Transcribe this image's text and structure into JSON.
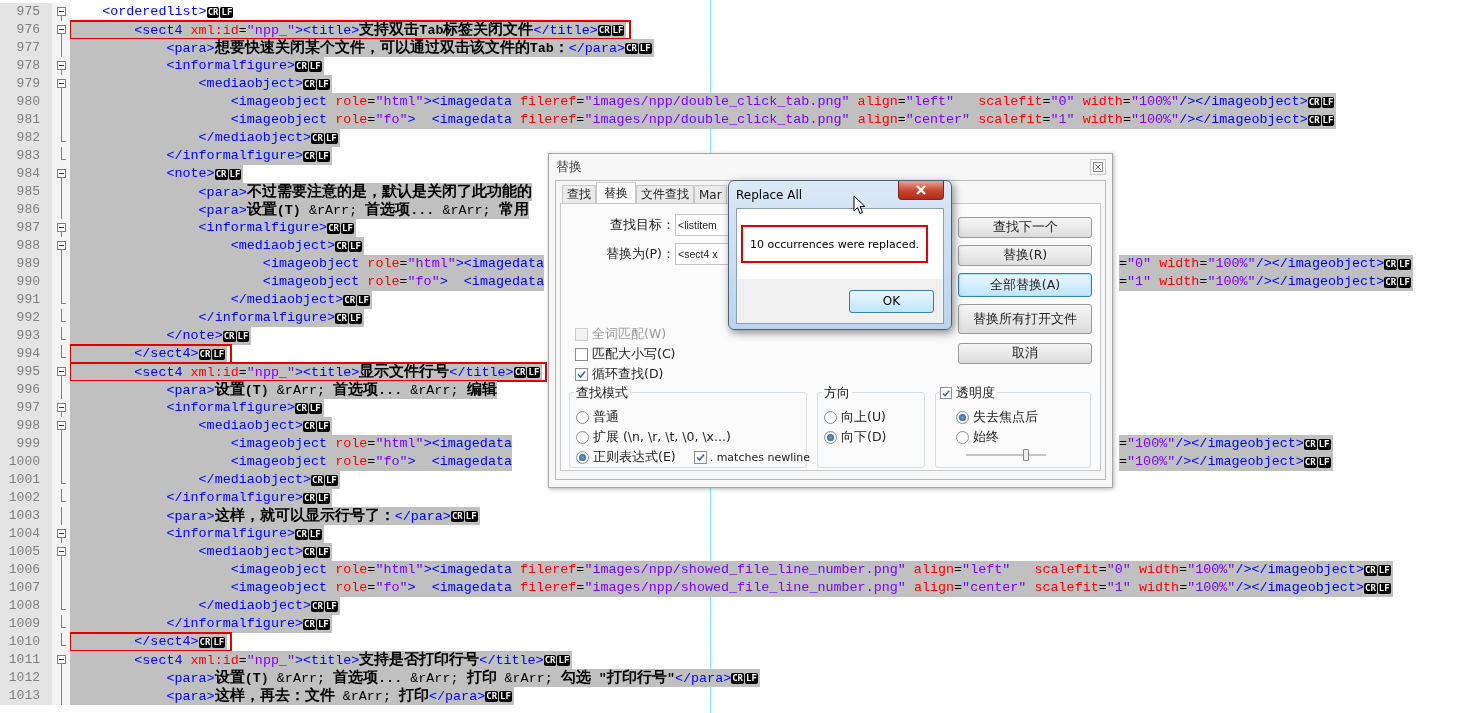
{
  "editor": {
    "lines": [
      {
        "number": "975",
        "kind": "start",
        "text": "    <orderedlist>",
        "eol": [
          "CR",
          "LF"
        ],
        "selected": false,
        "highlight": false
      },
      {
        "number": "976",
        "kind": "start",
        "text": "        <sect4 xml:id=\"npp_\"><title>支持双击Tab标签关闭文件</title>",
        "eol": [
          "CR",
          "LF"
        ],
        "selected": true,
        "highlight": true
      },
      {
        "number": "977",
        "kind": "inner",
        "text": "            <para>想要快速关闭某个文件，可以通过双击该文件的Tab：</para>",
        "eol": [
          "CR",
          "LF"
        ],
        "selected": true,
        "highlight": false
      },
      {
        "number": "978",
        "kind": "start",
        "text": "            <informalfigure>",
        "eol": [
          "CR",
          "LF"
        ],
        "selected": true,
        "highlight": false
      },
      {
        "number": "979",
        "kind": "start",
        "text": "                <mediaobject>",
        "eol": [
          "CR",
          "LF"
        ],
        "selected": true,
        "highlight": false
      },
      {
        "number": "980",
        "kind": "inner",
        "text": "                    <imageobject role=\"html\"><imagedata fileref=\"images/npp/double_click_tab.png\" align=\"left\"   scalefit=\"0\" width=\"100%\"/></imageobject>",
        "eol": [
          "CR",
          "LF"
        ],
        "selected": true,
        "highlight": false
      },
      {
        "number": "981",
        "kind": "inner",
        "text": "                    <imageobject role=\"fo\">  <imagedata fileref=\"images/npp/double_click_tab.png\" align=\"center\" scalefit=\"1\" width=\"100%\"/></imageobject>",
        "eol": [
          "CR",
          "LF"
        ],
        "selected": true,
        "highlight": false
      },
      {
        "number": "982",
        "kind": "end",
        "text": "                </mediaobject>",
        "eol": [
          "CR",
          "LF"
        ],
        "selected": true,
        "highlight": false
      },
      {
        "number": "983",
        "kind": "end",
        "text": "            </informalfigure>",
        "eol": [
          "CR",
          "LF"
        ],
        "selected": true,
        "highlight": false
      },
      {
        "number": "984",
        "kind": "start",
        "text": "            <note>",
        "eol": [
          "CR",
          "LF"
        ],
        "selected": true,
        "highlight": false
      },
      {
        "number": "985",
        "kind": "inner",
        "text": "                <para>不过需要注意的是，默认是关闭了此功能的",
        "selected": true,
        "highlight": false
      },
      {
        "number": "986",
        "kind": "inner",
        "text": "                <para>设置(T) &rArr; 首选项... &rArr; 常用",
        "selected": true,
        "highlight": false
      },
      {
        "number": "987",
        "kind": "start",
        "text": "                <informalfigure>",
        "eol": [
          "CR",
          "LF"
        ],
        "selected": true,
        "highlight": false
      },
      {
        "number": "988",
        "kind": "start",
        "text": "                    <mediaobject>",
        "eol": [
          "CR",
          "LF"
        ],
        "selected": true,
        "highlight": false
      },
      {
        "number": "989",
        "kind": "inner",
        "text": "                        <imageobject role=\"html\"><imagedata",
        "tail": "=\"0\" width=\"100%\"/></imageobject>",
        "eol": [
          "CR",
          "LF"
        ],
        "selected": true,
        "highlight": false
      },
      {
        "number": "990",
        "kind": "inner",
        "text": "                        <imageobject role=\"fo\">  <imagedata",
        "tail": "=\"1\" width=\"100%\"/></imageobject>",
        "eol": [
          "CR",
          "LF"
        ],
        "selected": true,
        "highlight": false
      },
      {
        "number": "991",
        "kind": "end",
        "text": "                    </mediaobject>",
        "eol": [
          "CR",
          "LF"
        ],
        "selected": true,
        "highlight": false
      },
      {
        "number": "992",
        "kind": "end",
        "text": "                </informalfigure>",
        "eol": [
          "CR",
          "LF"
        ],
        "selected": true,
        "highlight": false
      },
      {
        "number": "993",
        "kind": "end",
        "text": "            </note>",
        "eol": [
          "CR",
          "LF"
        ],
        "selected": true,
        "highlight": false
      },
      {
        "number": "994",
        "kind": "end",
        "text": "        </sect4>",
        "eol": [
          "CR",
          "LF"
        ],
        "selected": true,
        "highlight": true
      },
      {
        "number": "995",
        "kind": "start",
        "text": "        <sect4 xml:id=\"npp_\"><title>显示文件行号</title>",
        "eol": [
          "CR",
          "LF"
        ],
        "selected": true,
        "highlight": true
      },
      {
        "number": "996",
        "kind": "inner",
        "text": "            <para>设置(T) &rArr; 首选项... &rArr; 编辑",
        "selected": true,
        "highlight": false
      },
      {
        "number": "997",
        "kind": "start",
        "text": "            <informalfigure>",
        "eol": [
          "CR",
          "LF"
        ],
        "selected": true,
        "highlight": false
      },
      {
        "number": "998",
        "kind": "start",
        "text": "                <mediaobject>",
        "eol": [
          "CR",
          "LF"
        ],
        "selected": true,
        "highlight": false
      },
      {
        "number": "999",
        "kind": "inner",
        "text": "                    <imageobject role=\"html\"><imagedata",
        "tail": "=\"100%\"/></imageobject>",
        "eol": [
          "CR",
          "LF"
        ],
        "selected": true,
        "highlight": false
      },
      {
        "number": "1000",
        "kind": "inner",
        "text": "                    <imageobject role=\"fo\">  <imagedata",
        "tail": "=\"100%\"/></imageobject>",
        "eol": [
          "CR",
          "LF"
        ],
        "selected": true,
        "highlight": false
      },
      {
        "number": "1001",
        "kind": "end",
        "text": "                </mediaobject>",
        "eol": [
          "CR",
          "LF"
        ],
        "selected": true,
        "highlight": false
      },
      {
        "number": "1002",
        "kind": "end",
        "text": "            </informalfigure>",
        "eol": [
          "CR",
          "LF"
        ],
        "selected": true,
        "highlight": false
      },
      {
        "number": "1003",
        "kind": "inner",
        "text": "            <para>这样，就可以显示行号了：</para>",
        "eol": [
          "CR",
          "LF"
        ],
        "selected": true,
        "highlight": false
      },
      {
        "number": "1004",
        "kind": "start",
        "text": "            <informalfigure>",
        "eol": [
          "CR",
          "LF"
        ],
        "selected": true,
        "highlight": false
      },
      {
        "number": "1005",
        "kind": "start",
        "text": "                <mediaobject>",
        "eol": [
          "CR",
          "LF"
        ],
        "selected": true,
        "highlight": false
      },
      {
        "number": "1006",
        "kind": "inner",
        "text": "                    <imageobject role=\"html\"><imagedata fileref=\"images/npp/showed_file_line_number.png\" align=\"left\"   scalefit=\"0\" width=\"100%\"/></imageobject>",
        "eol": [
          "CR",
          "LF"
        ],
        "selected": true,
        "highlight": false
      },
      {
        "number": "1007",
        "kind": "inner",
        "text": "                    <imageobject role=\"fo\">  <imagedata fileref=\"images/npp/showed_file_line_number.png\" align=\"center\" scalefit=\"1\" width=\"100%\"/></imageobject>",
        "eol": [
          "CR",
          "LF"
        ],
        "selected": true,
        "highlight": false
      },
      {
        "number": "1008",
        "kind": "end",
        "text": "                </mediaobject>",
        "eol": [
          "CR",
          "LF"
        ],
        "selected": true,
        "highlight": false
      },
      {
        "number": "1009",
        "kind": "end",
        "text": "            </informalfigure>",
        "eol": [
          "CR",
          "LF"
        ],
        "selected": true,
        "highlight": false
      },
      {
        "number": "1010",
        "kind": "end",
        "text": "        </sect4>",
        "eol": [
          "CR",
          "LF"
        ],
        "selected": true,
        "highlight": true
      },
      {
        "number": "1011",
        "kind": "start",
        "text": "        <sect4 xml:id=\"npp_\"><title>支持是否打印行号</title>",
        "eol": [
          "CR",
          "LF"
        ],
        "selected": true,
        "highlight": false
      },
      {
        "number": "1012",
        "kind": "inner",
        "text": "            <para>设置(T) &rArr; 首选项... &rArr; 打印 &rArr; 勾选 \"打印行号\"</para>",
        "eol": [
          "CR",
          "LF"
        ],
        "selected": true,
        "highlight": false
      },
      {
        "number": "1013",
        "kind": "inner",
        "text": "            <para>这样，再去：文件 &rArr; 打印</para>",
        "eol": [
          "CR",
          "LF"
        ],
        "selected": true,
        "highlight": false
      }
    ]
  },
  "replace_dialog": {
    "title": "替换",
    "tabs": [
      {
        "label": "查找",
        "selected": false
      },
      {
        "label": "替换",
        "selected": true
      },
      {
        "label": "文件查找",
        "selected": false
      },
      {
        "label": "Mar",
        "selected": false
      }
    ],
    "fields": [
      {
        "label": "查找目标：",
        "value": "<listitem"
      },
      {
        "label": "替换为(P)：",
        "value": "<sect4 x"
      }
    ],
    "buttons": [
      {
        "label": "查找下一个",
        "focused": false
      },
      {
        "label": "替换(R)",
        "focused": false
      },
      {
        "label": "全部替换(A)",
        "focused": true
      },
      {
        "label": "替换所有打开文件",
        "focused": false
      },
      {
        "label": "取消",
        "focused": false
      }
    ],
    "options": [
      {
        "label": "全词匹配(W)",
        "checked": false,
        "disabled": true
      },
      {
        "label": "匹配大小写(C)",
        "checked": false,
        "disabled": false
      },
      {
        "label": "循环查找(D)",
        "checked": true,
        "disabled": false
      }
    ],
    "search_mode": {
      "title": "查找模式",
      "options": [
        {
          "label": "普通",
          "selected": false
        },
        {
          "label": "扩展 (\\n, \\r, \\t, \\0, \\x...)",
          "selected": false
        },
        {
          "label": "正则表达式(E)",
          "selected": true
        }
      ],
      "newline": {
        "label": ". matches newline",
        "checked": true
      }
    },
    "direction": {
      "title": "方向",
      "options": [
        {
          "label": "向上(U)",
          "selected": false
        },
        {
          "label": "向下(D)",
          "selected": true
        }
      ]
    },
    "transparency": {
      "label": "透明度",
      "checked": true,
      "options": [
        {
          "label": "失去焦点后",
          "selected": true
        },
        {
          "label": "始终",
          "selected": false
        }
      ],
      "level": 0.75
    }
  },
  "message_box": {
    "title": "Replace All",
    "message": "10 occurrences were replaced.",
    "highlight": true,
    "button": "OK"
  }
}
